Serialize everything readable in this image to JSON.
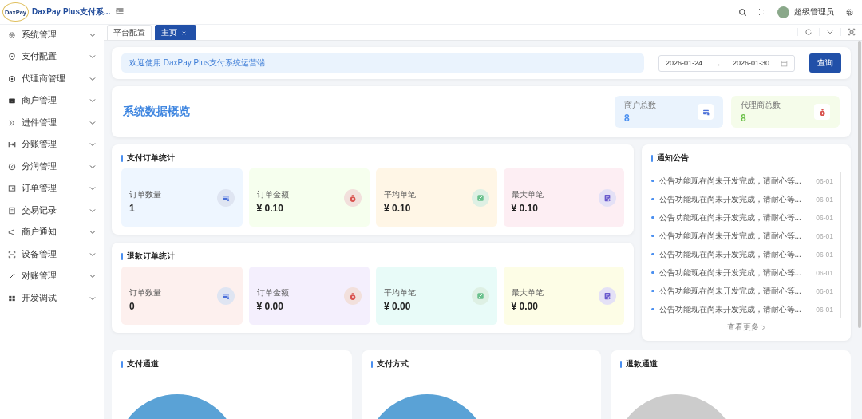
{
  "app": {
    "logo_text": "DaxPay",
    "title": "DaxPay Plus支付系..."
  },
  "header": {
    "user": "超级管理员"
  },
  "sidebar": {
    "items": [
      {
        "label": "系统管理",
        "expanded": false
      },
      {
        "label": "支付配置",
        "expanded": false
      },
      {
        "label": "代理商管理",
        "expanded": false
      },
      {
        "label": "商户管理",
        "expanded": false
      },
      {
        "label": "进件管理",
        "expanded": false
      },
      {
        "label": "分账管理",
        "expanded": false
      },
      {
        "label": "分润管理",
        "expanded": false
      },
      {
        "label": "订单管理",
        "expanded": false
      },
      {
        "label": "交易记录",
        "expanded": false
      },
      {
        "label": "商户通知",
        "expanded": false
      },
      {
        "label": "设备管理",
        "expanded": false
      },
      {
        "label": "对账管理",
        "expanded": false
      },
      {
        "label": "开发调试",
        "expanded": false
      }
    ]
  },
  "tabs": [
    {
      "label": "平台配置",
      "selected": false,
      "closable": false
    },
    {
      "label": "主页",
      "selected": true,
      "closable": true
    }
  ],
  "welcome": "欢迎使用 DaxPay Plus支付系统运营端",
  "date_range": {
    "start": "2026-01-24",
    "separator": "→",
    "end": "2026-01-30"
  },
  "query_button": "查询",
  "overview": {
    "title": "系统数据概览",
    "counters": [
      {
        "label": "商户总数",
        "value": "8",
        "kind": "card",
        "color": "#4a8ff0"
      },
      {
        "label": "代理商总数",
        "value": "8",
        "kind": "bag",
        "color": "#6cc04a"
      }
    ]
  },
  "payment_stats": {
    "title": "支付订单统计",
    "cards": [
      {
        "label": "订单数量",
        "value": "1",
        "kind": "card",
        "color": "#eef6ff"
      },
      {
        "label": "订单金额",
        "value": "¥ 0.10",
        "kind": "bag",
        "color": "#f6ffee"
      },
      {
        "label": "平均单笔",
        "value": "¥ 0.10",
        "kind": "percent",
        "color": "#fff6e6"
      },
      {
        "label": "最大单笔",
        "value": "¥ 0.10",
        "kind": "doc",
        "color": "#fdeef3"
      }
    ]
  },
  "refund_stats": {
    "title": "退款订单统计",
    "cards": [
      {
        "label": "订单数量",
        "value": "0",
        "kind": "card",
        "color": "#fdf0ee"
      },
      {
        "label": "订单金额",
        "value": "¥ 0.00",
        "kind": "bag",
        "color": "#f4effd"
      },
      {
        "label": "平均单笔",
        "value": "¥ 0.00",
        "kind": "percent",
        "color": "#e8fbf8"
      },
      {
        "label": "最大单笔",
        "value": "¥ 0.00",
        "kind": "doc",
        "color": "#fdfde6"
      }
    ]
  },
  "notices": {
    "title": "通知公告",
    "items": [
      {
        "text": "公告功能现在尚未开发完成，请耐心等...",
        "date": "06-01"
      },
      {
        "text": "公告功能现在尚未开发完成，请耐心等...",
        "date": "06-01"
      },
      {
        "text": "公告功能现在尚未开发完成，请耐心等...",
        "date": "06-01"
      },
      {
        "text": "公告功能现在尚未开发完成，请耐心等...",
        "date": "06-01"
      },
      {
        "text": "公告功能现在尚未开发完成，请耐心等...",
        "date": "06-01"
      },
      {
        "text": "公告功能现在尚未开发完成，请耐心等...",
        "date": "06-01"
      },
      {
        "text": "公告功能现在尚未开发完成，请耐心等...",
        "date": "06-01"
      },
      {
        "text": "公告功能现在尚未开发完成，请耐心等...",
        "date": "06-01"
      }
    ],
    "more": "查看更多"
  },
  "charts": [
    {
      "title": "支付通道",
      "color": "#5aa2d6"
    },
    {
      "title": "支付方式",
      "color": "#5aa2d6"
    },
    {
      "title": "退款通道",
      "color": "#cccccc"
    }
  ]
}
